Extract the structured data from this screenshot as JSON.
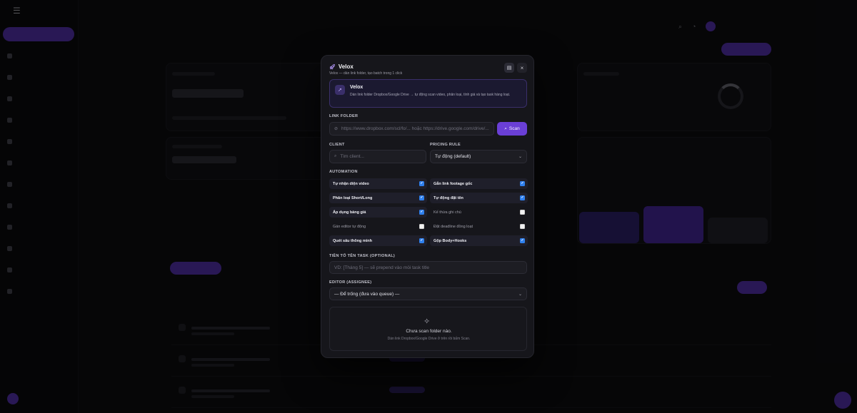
{
  "modal": {
    "title": "Velox",
    "title_icon": "rocket-icon",
    "subtitle": "Velox — dán link folder, tạo batch trong 1 click",
    "info": {
      "title": "Velox",
      "description": "Dán link folder Dropbox/Google Drive → tự động scan video, phân loại, tính giá và tạo task hàng loạt."
    },
    "link_folder": {
      "label": "LINK FOLDER",
      "placeholder": "https://www.dropbox.com/scl/fo/... hoặc https://drive.google.com/drive/...",
      "scan_label": "Scan"
    },
    "client": {
      "label": "CLIENT",
      "placeholder": "Tìm client..."
    },
    "pricing_rule": {
      "label": "PRICING RULE",
      "selected": "Tự động (default)"
    },
    "automation": {
      "label": "AUTOMATION",
      "options": [
        {
          "label": "Tự nhận diện video",
          "checked": true
        },
        {
          "label": "Gắn link footage gốc",
          "checked": true
        },
        {
          "label": "Phân loại Short/Long",
          "checked": true
        },
        {
          "label": "Tự động đặt tên",
          "checked": true
        },
        {
          "label": "Áp dụng bảng giá",
          "checked": true
        },
        {
          "label": "Kế thừa ghi chú",
          "checked": false
        },
        {
          "label": "Gán editor tự động",
          "checked": false
        },
        {
          "label": "Đặt deadline đồng loạt",
          "checked": false
        },
        {
          "label": "Quét sâu thông minh",
          "checked": true
        },
        {
          "label": "Gộp Body+Hooks",
          "checked": true
        }
      ]
    },
    "prefix": {
      "label": "TIỀN TỐ TÊN TASK (OPTIONAL)",
      "placeholder": "VD: [Tháng 5] — sẽ prepend vào mỗi task title"
    },
    "editor": {
      "label": "EDITOR (ASSIGNEE)",
      "selected": "— Để trống (đưa vào queue) —"
    },
    "empty_state": {
      "title": "Chưa scan folder nào.",
      "subtitle": "Dán link Dropbox/Google Drive ở trên rồi bấm Scan."
    }
  },
  "colors": {
    "accent": "#6a3fd6",
    "checkbox_on": "#2f80ed"
  }
}
